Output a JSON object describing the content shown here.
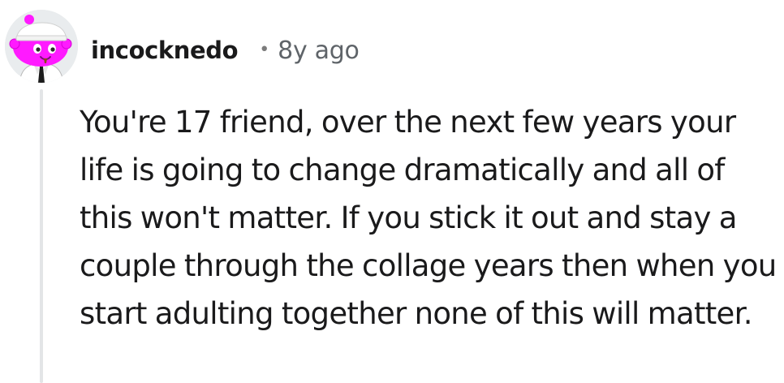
{
  "comment": {
    "username": "incocknedo",
    "separator": "•",
    "time_ago": "8y ago",
    "body": "You're 17 friend, over the next few years your life is going to change dramatically and all of this won't matter. If you stick it out and stay a couple through the collage years then when you start adulting together none of this will matter."
  },
  "avatar": {
    "icon": "snoo-avatar-icon",
    "colors": {
      "head": "#ff1aff",
      "background": "#e9ecee",
      "hat": "#ffffff"
    }
  }
}
